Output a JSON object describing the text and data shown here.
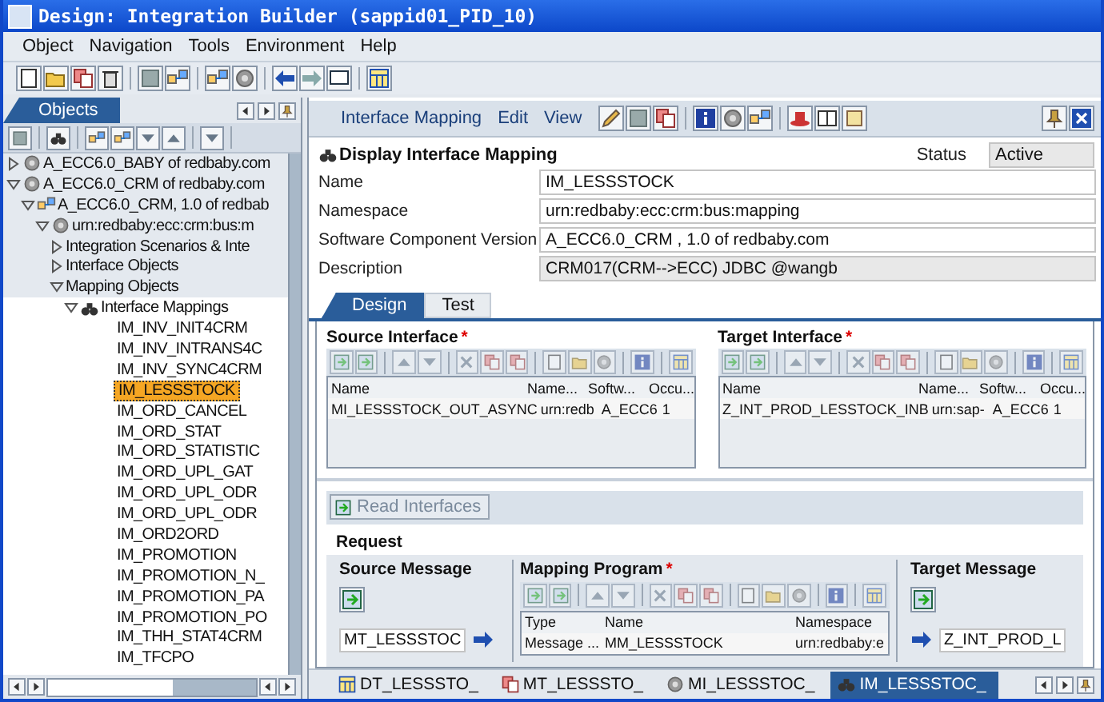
{
  "window": {
    "title": "Design: Integration Builder (sappid01_PID_10)"
  },
  "menu": [
    "Object",
    "Navigation",
    "Tools",
    "Environment",
    "Help"
  ],
  "objects_panel": {
    "tab": "Objects",
    "tree": [
      {
        "label": "A_ECC6.0_BABY of redbaby.com",
        "kind": "component",
        "expanded": false
      },
      {
        "label": "A_ECC6.0_CRM of redbaby.com",
        "kind": "component",
        "expanded": true,
        "children": [
          {
            "label": "A_ECC6.0_CRM, 1.0 of redbab",
            "kind": "version",
            "expanded": true,
            "children": [
              {
                "label": "urn:redbaby:ecc:crm:bus:m",
                "kind": "namespace",
                "expanded": true,
                "children": [
                  {
                    "label": "Integration Scenarios & Inte",
                    "kind": "folder",
                    "expanded": false
                  },
                  {
                    "label": "Interface Objects",
                    "kind": "folder",
                    "expanded": false
                  },
                  {
                    "label": "Mapping Objects",
                    "kind": "folder",
                    "expanded": true,
                    "children": [
                      {
                        "label": "Interface Mappings",
                        "kind": "mappings",
                        "expanded": true,
                        "children": [
                          {
                            "label": "IM_INV_INIT4CRM",
                            "kind": "leaf",
                            "selected": false
                          },
                          {
                            "label": "IM_INV_INTRANS4C",
                            "kind": "leaf",
                            "selected": false
                          },
                          {
                            "label": "IM_INV_SYNC4CRM",
                            "kind": "leaf",
                            "selected": false
                          },
                          {
                            "label": "IM_LESSSTOCK",
                            "kind": "leaf",
                            "selected": true
                          },
                          {
                            "label": "IM_ORD_CANCEL",
                            "kind": "leaf",
                            "selected": false
                          },
                          {
                            "label": "IM_ORD_STAT",
                            "kind": "leaf",
                            "selected": false
                          },
                          {
                            "label": "IM_ORD_STATISTIC",
                            "kind": "leaf",
                            "selected": false
                          },
                          {
                            "label": "IM_ORD_UPL_GAT",
                            "kind": "leaf",
                            "selected": false
                          },
                          {
                            "label": "IM_ORD_UPL_ODR",
                            "kind": "leaf",
                            "selected": false
                          },
                          {
                            "label": "IM_ORD_UPL_ODR",
                            "kind": "leaf",
                            "selected": false
                          },
                          {
                            "label": "IM_ORD2ORD",
                            "kind": "leaf",
                            "selected": false
                          },
                          {
                            "label": "IM_PROMOTION",
                            "kind": "leaf",
                            "selected": false
                          },
                          {
                            "label": "IM_PROMOTION_N_",
                            "kind": "leaf",
                            "selected": false
                          },
                          {
                            "label": "IM_PROMOTION_PA",
                            "kind": "leaf",
                            "selected": false
                          },
                          {
                            "label": "IM_PROMOTION_PO",
                            "kind": "leaf",
                            "selected": false
                          },
                          {
                            "label": "IM_THH_STAT4CRM",
                            "kind": "leaf",
                            "selected": false
                          },
                          {
                            "label": "IM_TFCPO",
                            "kind": "leaf",
                            "selected": false
                          }
                        ]
                      }
                    ]
                  }
                ]
              }
            ]
          }
        ]
      }
    ]
  },
  "editor": {
    "menus": [
      "Interface Mapping",
      "Edit",
      "View"
    ],
    "heading": "Display Interface Mapping",
    "status_label": "Status",
    "status_value": "Active",
    "fields": [
      {
        "label": "Name",
        "value": "IM_LESSSTOCK"
      },
      {
        "label": "Namespace",
        "value": "urn:redbaby:ecc:crm:bus:mapping"
      },
      {
        "label": "Software Component Version",
        "value": "A_ECC6.0_CRM , 1.0 of redbaby.com"
      },
      {
        "label": "Description",
        "value": "CRM017(CRM-->ECC) JDBC @wangb"
      }
    ],
    "tabs": [
      {
        "label": "Design",
        "selected": true
      },
      {
        "label": "Test",
        "selected": false
      }
    ],
    "source_interface": {
      "title": "Source Interface",
      "required_mark": "*",
      "columns": [
        "Name",
        "Name...",
        "Softw...",
        "Occu..."
      ],
      "rows": [
        [
          "MI_LESSSTOCK_OUT_ASYNC",
          "urn:redb",
          "A_ECC6",
          "1"
        ]
      ]
    },
    "target_interface": {
      "title": "Target Interface",
      "required_mark": "*",
      "columns": [
        "Name",
        "Name...",
        "Softw...",
        "Occu..."
      ],
      "rows": [
        [
          "Z_INT_PROD_LESSTOCK_INB",
          "urn:sap-",
          "A_ECC6",
          "1"
        ]
      ]
    },
    "read_button": "Read Interfaces",
    "request_label": "Request",
    "source_message": {
      "title": "Source Message",
      "value": "MT_LESSSTOC"
    },
    "mapping_program": {
      "title": "Mapping Program",
      "required_mark": "*",
      "columns": [
        "Type",
        "Name",
        "Namespace"
      ],
      "rows": [
        [
          "Message ...",
          "MM_LESSSTOCK",
          "urn:redbaby:e"
        ]
      ]
    },
    "target_message": {
      "title": "Target Message",
      "value": "Z_INT_PROD_L"
    }
  },
  "editor_tabs": [
    {
      "label": "DT_LESSSTO_",
      "kind": "data-type",
      "selected": false
    },
    {
      "label": "MT_LESSSTO_",
      "kind": "message-type",
      "selected": false
    },
    {
      "label": "MI_LESSSTOC_",
      "kind": "message-interface",
      "selected": false
    },
    {
      "label": "IM_LESSSTOC_",
      "kind": "interface-mapping",
      "selected": true
    }
  ]
}
